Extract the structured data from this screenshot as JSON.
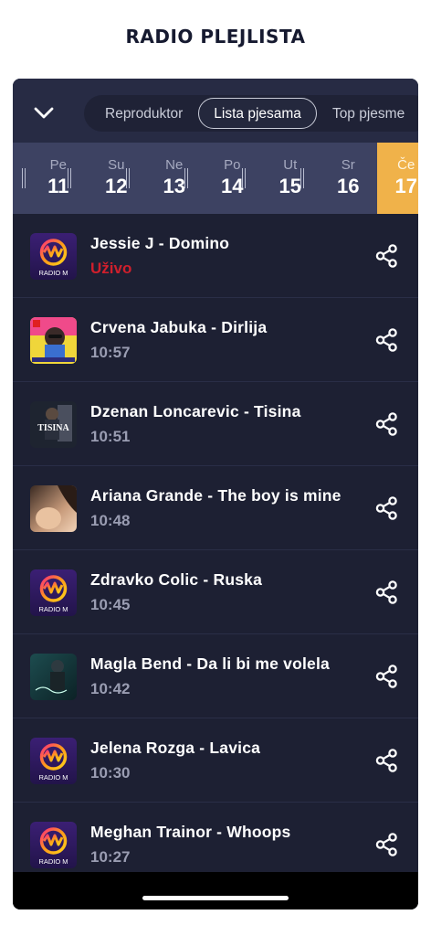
{
  "header": {
    "title": "RADIO PLEJLISTA"
  },
  "tabs": [
    {
      "label": "Reproduktor",
      "active": false
    },
    {
      "label": "Lista pjesama",
      "active": true
    },
    {
      "label": "Top pjesme",
      "active": false
    }
  ],
  "days": [
    {
      "name": "Pe",
      "num": "11"
    },
    {
      "name": "Su",
      "num": "12"
    },
    {
      "name": "Ne",
      "num": "13"
    },
    {
      "name": "Po",
      "num": "14"
    },
    {
      "name": "Ut",
      "num": "15"
    },
    {
      "name": "Sr",
      "num": "16"
    },
    {
      "name": "Če",
      "num": "17",
      "selected": true
    }
  ],
  "thumb_labels": {
    "radio_m": "RADIO M",
    "tisina": "TISINA"
  },
  "songs": [
    {
      "title": "Jessie J - Domino",
      "time": "Uživo",
      "live": true,
      "art": "radio-m"
    },
    {
      "title": "Crvena Jabuka - Dirlija",
      "time": "10:57",
      "art": "crvena-jabuka"
    },
    {
      "title": "Dzenan Loncarevic - Tisina",
      "time": "10:51",
      "art": "tisina"
    },
    {
      "title": "Ariana Grande - The boy is mine",
      "time": "10:48",
      "art": "ariana"
    },
    {
      "title": "Zdravko Colic - Ruska",
      "time": "10:45",
      "art": "radio-m"
    },
    {
      "title": "Magla Bend - Da li bi me volela",
      "time": "10:42",
      "art": "magla"
    },
    {
      "title": "Jelena Rozga - Lavica",
      "time": "10:30",
      "art": "radio-m"
    },
    {
      "title": "Meghan Trainor - Whoops",
      "time": "10:27",
      "art": "radio-m"
    }
  ],
  "colors": {
    "accent_day": "#f0b24a",
    "live": "#d01f2c",
    "background": "#1d2033"
  },
  "icons": {
    "collapse": "chevron-down-icon",
    "share": "share-icon"
  }
}
